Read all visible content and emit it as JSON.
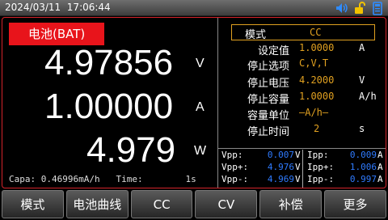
{
  "status_bar": {
    "datetime": "2024/03/11  17:06:44",
    "icons": [
      "speaker-icon",
      "unlock-icon",
      "usb-storage-icon"
    ],
    "colors": {
      "speaker": "#2f8cff",
      "lock": "#f2c200",
      "storage": "#2f8cff"
    }
  },
  "left_panel": {
    "mode_label": "电池(BAT)",
    "voltage": {
      "value": "4.97856",
      "unit": "V"
    },
    "current": {
      "value": "1.00000",
      "unit": "A"
    },
    "power": {
      "value": "4.979",
      "unit": "W"
    },
    "footer": "Capa: 0.46996mA/h   Time:        1s"
  },
  "settings": {
    "header_key": "模式",
    "header_value": "CC",
    "rows": [
      {
        "key": "设定值",
        "value": "1.0000",
        "unit": "A"
      },
      {
        "key": "停止选项",
        "value": "C,V,T",
        "unit": ""
      },
      {
        "key": "停止电压",
        "value": "4.2000",
        "unit": "V"
      },
      {
        "key": "停止容量",
        "value": "1.0000",
        "unit": "A/h"
      },
      {
        "key": "容量单位",
        "value": "—A/h—",
        "unit": ""
      },
      {
        "key": "停止时间",
        "value": "2",
        "unit": "s"
      }
    ]
  },
  "measurements": {
    "left": [
      {
        "key": "Vpp:",
        "value": "0.007",
        "unit": "V"
      },
      {
        "key": "Vpp+:",
        "value": "4.976",
        "unit": "V"
      },
      {
        "key": "Vpp-:",
        "value": "4.969",
        "unit": "V"
      }
    ],
    "right": [
      {
        "key": "Ipp:",
        "value": "0.009",
        "unit": "A"
      },
      {
        "key": "Ipp+:",
        "value": "1.006",
        "unit": "A"
      },
      {
        "key": "Ipp-:",
        "value": "0.997",
        "unit": "A"
      }
    ]
  },
  "softkeys": [
    "模式",
    "电池曲线",
    "CC",
    "CV",
    "补偿",
    "更多"
  ],
  "colors": {
    "accent_red": "#e8141b",
    "border_red": "#d4232a",
    "value_amber": "#e0a020",
    "meas_blue": "#2f7bff"
  }
}
